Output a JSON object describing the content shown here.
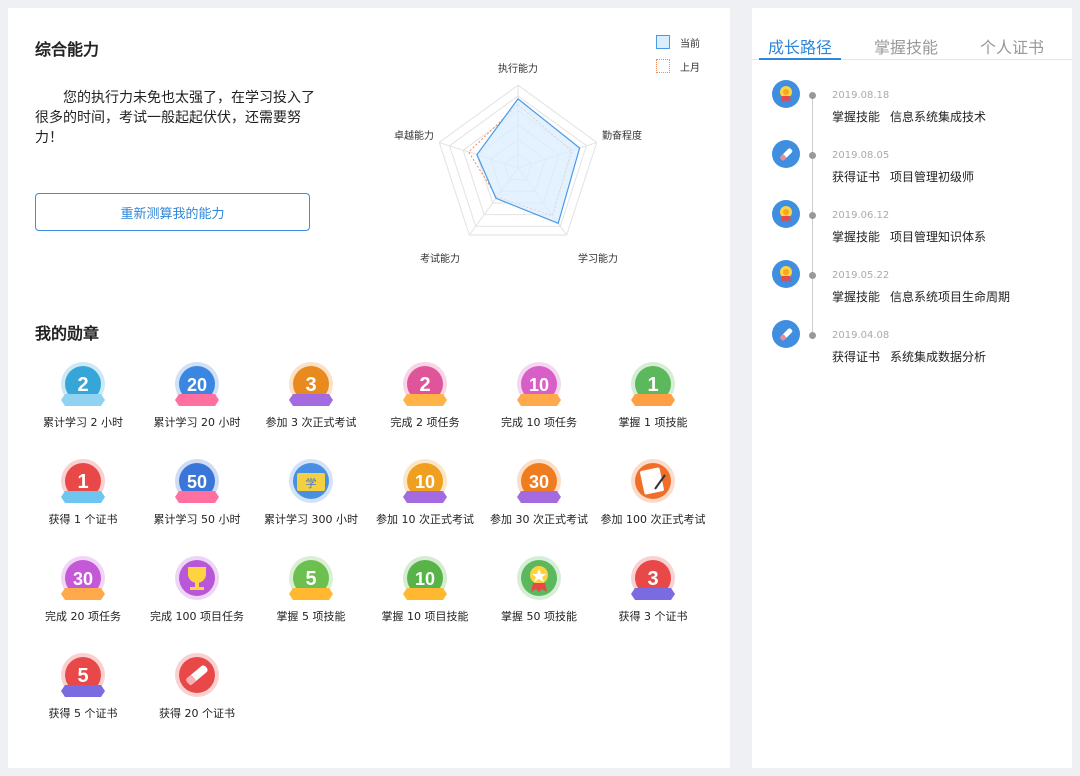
{
  "ability": {
    "title": "综合能力",
    "summary": "您的执行力未免也太强了，在学习投入了很多的时间，考试一般起起伏伏，还需要努力！",
    "recalc_button": "重新测算我的能力"
  },
  "legend": {
    "current": "当前",
    "previous": "上月"
  },
  "colors": {
    "accent": "#2f86d8",
    "current_stroke": "#4a9ae8",
    "current_fill": "#dbeeff",
    "previous_stroke": "#f08a5a"
  },
  "chart_data": {
    "type": "radar",
    "axes": [
      "执行能力",
      "勤奋程度",
      "学习能力",
      "考试能力",
      "卓越能力"
    ],
    "max": 100,
    "series": [
      {
        "name": "当前",
        "values": [
          96,
          90,
          95,
          52,
          60
        ]
      },
      {
        "name": "上月",
        "values": [
          88,
          78,
          82,
          50,
          72
        ]
      }
    ]
  },
  "badges": {
    "title": "我的勋章",
    "items": [
      {
        "num": "2",
        "label": "累计学习 2 小时",
        "color": "#36a6d8",
        "ribbon": "#8fd3f0",
        "icon": "number-badge-icon"
      },
      {
        "num": "20",
        "label": "累计学习 20 小时",
        "color": "#3a86e0",
        "ribbon": "#ff6fa0",
        "icon": "number-badge-icon"
      },
      {
        "num": "3",
        "label": "参加 3 次正式考试",
        "color": "#e88a1e",
        "ribbon": "#a46be0",
        "icon": "number-badge-icon"
      },
      {
        "num": "2",
        "label": "完成 2 项任务",
        "color": "#e0559a",
        "ribbon": "#ffb347",
        "icon": "number-badge-icon"
      },
      {
        "num": "10",
        "label": "完成 10 项任务",
        "color": "#d85ec8",
        "ribbon": "#ffa94d",
        "icon": "number-badge-icon"
      },
      {
        "num": "1",
        "label": "掌握 1 项技能",
        "color": "#5cb85c",
        "ribbon": "#ff9f43",
        "icon": "number-badge-icon"
      },
      {
        "num": "1",
        "label": "获得 1 个证书",
        "color": "#e84848",
        "ribbon": "#6ec6f0",
        "icon": "number-badge-icon"
      },
      {
        "num": "50",
        "label": "累计学习 50 小时",
        "color": "#3a76d8",
        "ribbon": "#ff6fa0",
        "icon": "number-badge-icon"
      },
      {
        "num": "学",
        "label": "累计学习 300 小时",
        "color": "#4a90e2",
        "ribbon": "#f4d03f",
        "icon": "book-icon"
      },
      {
        "num": "10",
        "label": "参加 10 次正式考试",
        "color": "#f0a020",
        "ribbon": "#a46be0",
        "icon": "number-badge-icon"
      },
      {
        "num": "30",
        "label": "参加 30 次正式考试",
        "color": "#ef7c1e",
        "ribbon": "#a46be0",
        "icon": "number-badge-icon"
      },
      {
        "num": "",
        "label": "参加 100 次正式考试",
        "color": "#ef6f2a",
        "ribbon": "#ef6f2a",
        "icon": "exam-paper-icon"
      },
      {
        "num": "30",
        "label": "完成 20 项任务",
        "color": "#c458d8",
        "ribbon": "#ffa94d",
        "icon": "number-badge-icon"
      },
      {
        "num": "",
        "label": "完成 100 项目任务",
        "color": "#b857d8",
        "ribbon": "#b857d8",
        "icon": "trophy-icon"
      },
      {
        "num": "5",
        "label": "掌握 5 项技能",
        "color": "#6cc050",
        "ribbon": "#ffb830",
        "icon": "number-badge-icon"
      },
      {
        "num": "10",
        "label": "掌握 10 项目技能",
        "color": "#58b448",
        "ribbon": "#ffb830",
        "icon": "number-badge-icon"
      },
      {
        "num": "",
        "label": "掌握 50 项技能",
        "color": "#5cb85c",
        "ribbon": "#5cb85c",
        "icon": "star-medal-icon"
      },
      {
        "num": "3",
        "label": "获得 3 个证书",
        "color": "#e84848",
        "ribbon": "#7b6be0",
        "icon": "number-badge-icon"
      },
      {
        "num": "5",
        "label": "获得 5 个证书",
        "color": "#e84848",
        "ribbon": "#7b6be0",
        "icon": "number-badge-icon"
      },
      {
        "num": "",
        "label": "获得 20 个证书",
        "color": "#e84848",
        "ribbon": "#e84848",
        "icon": "certificate-icon"
      }
    ]
  },
  "side": {
    "tabs": [
      "成长路径",
      "掌握技能",
      "个人证书"
    ],
    "timeline": [
      {
        "date": "2019.08.18",
        "type": "掌握技能",
        "text": "信息系统集成技术",
        "icon": "medal-icon"
      },
      {
        "date": "2019.08.05",
        "type": "获得证书",
        "text": "项目管理初级师",
        "icon": "certificate-icon"
      },
      {
        "date": "2019.06.12",
        "type": "掌握技能",
        "text": "项目管理知识体系",
        "icon": "medal-icon"
      },
      {
        "date": "2019.05.22",
        "type": "掌握技能",
        "text": "信息系统项目生命周期",
        "icon": "medal-icon"
      },
      {
        "date": "2019.04.08",
        "type": "获得证书",
        "text": "系统集成数据分析",
        "icon": "certificate-icon"
      }
    ]
  }
}
